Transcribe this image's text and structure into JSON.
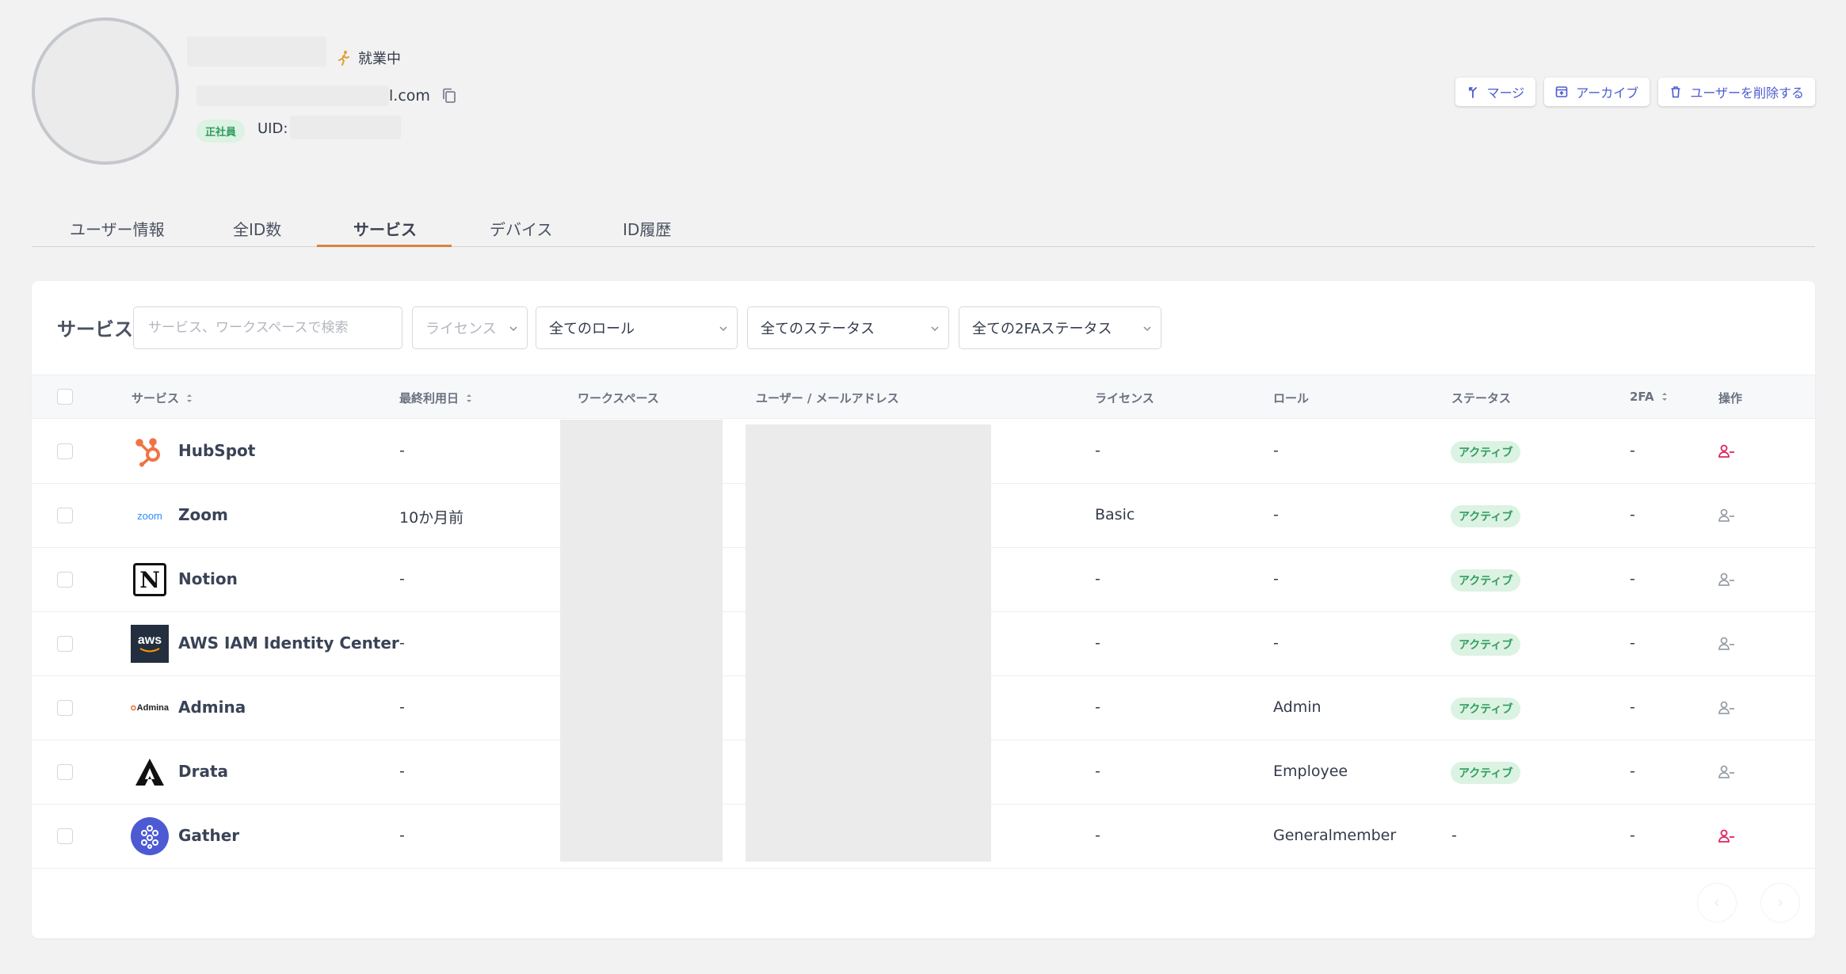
{
  "profile": {
    "work_status": "就業中",
    "email_suffix": "l.com",
    "employment_badge": "正社員",
    "uid_label": "UID:"
  },
  "actions": {
    "merge": "マージ",
    "archive": "アーカイブ",
    "delete": "ユーザーを削除する"
  },
  "tabs": [
    {
      "label": "ユーザー情報"
    },
    {
      "label": "全ID数"
    },
    {
      "label": "サービス",
      "active": true
    },
    {
      "label": "デバイス"
    },
    {
      "label": "ID履歴"
    }
  ],
  "services_panel": {
    "title": "サービス",
    "search_placeholder": "サービス、ワークスペースで検索",
    "filters": {
      "license": "ライセンス",
      "role": "全てのロール",
      "status": "全てのステータス",
      "twofa": "全ての2FAステータス"
    },
    "columns": {
      "service": "サービス",
      "last_used": "最終利用日",
      "workspace": "ワークスペース",
      "user_email": "ユーザー / メールアドレス",
      "license": "ライセンス",
      "role": "ロール",
      "status": "ステータス",
      "twofa": "2FA",
      "actions": "操作"
    },
    "rows": [
      {
        "service": "HubSpot",
        "logo": "hubspot-logo",
        "last_used": "-",
        "license": "-",
        "role": "-",
        "status": "アクティブ",
        "twofa": "-",
        "action_icon": "remove-user-icon",
        "action_color": "#e0245e"
      },
      {
        "service": "Zoom",
        "logo": "zoom-logo",
        "logo_text": "zoom",
        "last_used": "10か月前",
        "license": "Basic",
        "role": "-",
        "status": "アクティブ",
        "twofa": "-",
        "action_icon": "remove-user-icon",
        "action_color": "#9aa0a8"
      },
      {
        "service": "Notion",
        "logo": "notion-logo",
        "logo_text": "N",
        "last_used": "-",
        "license": "-",
        "role": "-",
        "status": "アクティブ",
        "twofa": "-",
        "action_icon": "remove-user-icon",
        "action_color": "#9aa0a8"
      },
      {
        "service": "AWS IAM Identity Center",
        "logo": "aws-logo",
        "logo_text": "aws",
        "last_used": "-",
        "license": "-",
        "role": "-",
        "status": "アクティブ",
        "twofa": "-",
        "action_icon": "remove-user-icon",
        "action_color": "#9aa0a8"
      },
      {
        "service": "Admina",
        "logo": "admina-logo",
        "logo_text": "Admina",
        "last_used": "-",
        "license": "-",
        "role": "Admin",
        "status": "アクティブ",
        "twofa": "-",
        "action_icon": "remove-user-icon",
        "action_color": "#9aa0a8"
      },
      {
        "service": "Drata",
        "logo": "drata-logo",
        "last_used": "-",
        "license": "-",
        "role": "Employee",
        "status": "アクティブ",
        "twofa": "-",
        "action_icon": "remove-user-icon",
        "action_color": "#9aa0a8"
      },
      {
        "service": "Gather",
        "logo": "gather-logo",
        "last_used": "-",
        "license": "-",
        "role": "Generalmember",
        "status": "-",
        "twofa": "-",
        "action_icon": "remove-user-icon",
        "action_color": "#e0245e"
      }
    ]
  },
  "colors": {
    "accent": "#4a5bd0",
    "tab_underline": "#d9823c",
    "active_badge_bg": "#dcf2e3",
    "active_badge_text": "#2f9d5c"
  }
}
